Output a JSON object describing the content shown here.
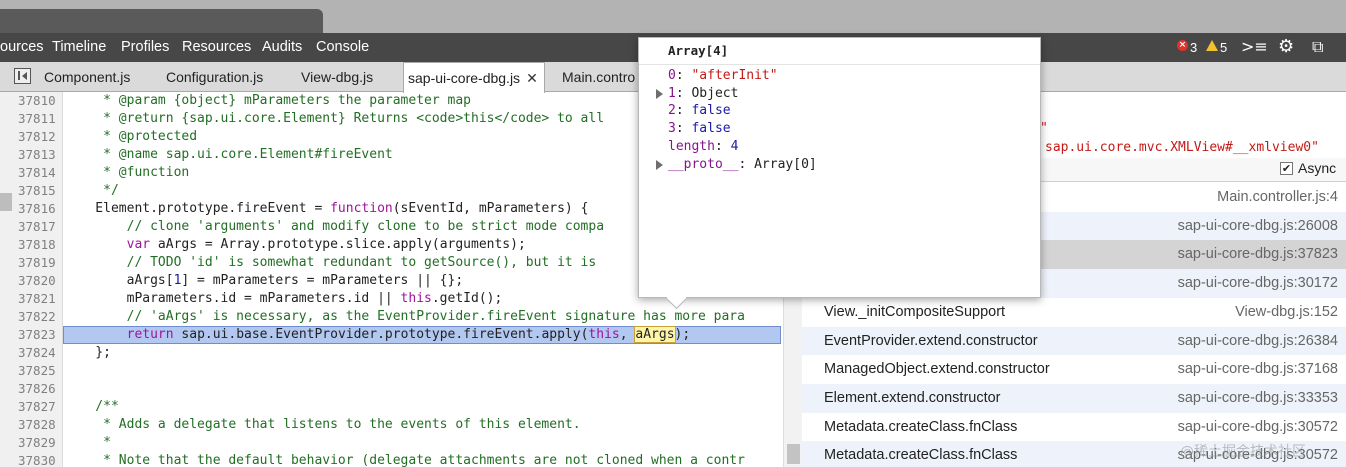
{
  "nav": {
    "items": [
      "ources",
      "Timeline",
      "Profiles",
      "Resources",
      "Audits",
      "Console"
    ],
    "errors": "3",
    "warnings": "5"
  },
  "file_tabs": [
    {
      "label": "Component.js",
      "active": false
    },
    {
      "label": "Configuration.js",
      "active": false
    },
    {
      "label": "View-dbg.js",
      "active": false
    },
    {
      "label": "sap-ui-core-dbg.js",
      "active": true
    },
    {
      "label": "Main.contro",
      "active": false
    }
  ],
  "close_glyph": "✕",
  "code_lines": [
    {
      "n": "37810",
      "html": "<span class=\"c\">     * @param {object} mParameters the parameter map</span>"
    },
    {
      "n": "37811",
      "html": "<span class=\"c\">     * @return {sap.ui.core.Element} Returns &lt;code&gt;this&lt;/code&gt; to all</span>"
    },
    {
      "n": "37812",
      "html": "<span class=\"c\">     * @protected</span>"
    },
    {
      "n": "37813",
      "html": "<span class=\"c\">     * @name sap.ui.core.Element#fireEvent</span>"
    },
    {
      "n": "37814",
      "html": "<span class=\"c\">     * @function</span>"
    },
    {
      "n": "37815",
      "html": "<span class=\"c\">     */</span>"
    },
    {
      "n": "37816",
      "html": "    Element.prototype.fireEvent = <span class=\"k\">function</span>(sEventId, mParameters) {"
    },
    {
      "n": "37817",
      "html": "<span class=\"c\">        // clone 'arguments' and modify clone to be strict mode compa</span>"
    },
    {
      "n": "37818",
      "html": "        <span class=\"k\">var</span> aArgs = Array.prototype.slice.apply(arguments);"
    },
    {
      "n": "37819",
      "html": "<span class=\"c\">        // TODO 'id' is somewhat redundant to getSource(), but it is</span>"
    },
    {
      "n": "37820",
      "html": "        aArgs[<span class=\"n\">1</span>] = mParameters = mParameters || {};"
    },
    {
      "n": "37821",
      "html": "        mParameters.id = mParameters.id || <span class=\"k\">this</span>.getId();"
    },
    {
      "n": "37822",
      "html": "<span class=\"c\">        // 'aArgs' is necessary, as the EventProvider.fireEvent signature has more para</span>"
    },
    {
      "n": "37823",
      "html": "        <span class=\"k\">return</span> sap.ui.base.EventProvider.prototype.fireEvent.apply(<span class=\"k\">this</span>, <span class=\"tok\">aArgs</span>);",
      "highlight": true
    },
    {
      "n": "37824",
      "html": "    };"
    },
    {
      "n": "37825",
      "html": ""
    },
    {
      "n": "37826",
      "html": ""
    },
    {
      "n": "37827",
      "html": "<span class=\"c\">    /**</span>"
    },
    {
      "n": "37828",
      "html": "<span class=\"c\">     * Adds a delegate that listens to the events of this element.</span>"
    },
    {
      "n": "37829",
      "html": "<span class=\"c\">     *</span>"
    },
    {
      "n": "37830",
      "html": "<span class=\"c\">     * Note that the default behavior (delegate attachments are not cloned when a contr</span>"
    }
  ],
  "popover": {
    "title": "Array[4]",
    "rows": [
      {
        "key": "0",
        "value": "\"afterInit\"",
        "vclass": "ps",
        "tri": false
      },
      {
        "key": "1",
        "value": "Object",
        "vclass": "pp",
        "tri": true
      },
      {
        "key": "2",
        "value": "false",
        "vclass": "pb",
        "tri": false
      },
      {
        "key": "3",
        "value": "false",
        "vclass": "pb",
        "tri": false
      },
      {
        "key": "length",
        "value": "4",
        "vclass": "pb",
        "tri": false
      },
      {
        "key": "__proto__",
        "value": "Array[0]",
        "vclass": "pp",
        "tri": true
      }
    ]
  },
  "right_panel": {
    "red_text_1": "\"",
    "red_text_2": "sap.ui.core.mvc.XMLView#__xmlview0\"",
    "async_label": "Async",
    "async_checked": "✔",
    "frames": [
      {
        "name": "",
        "loc": "Main.controller.js:4",
        "bg": "#ffffff"
      },
      {
        "name": "",
        "loc": "sap-ui-core-dbg.js:26008",
        "bg": "#eef3fb"
      },
      {
        "name": "",
        "loc": "sap-ui-core-dbg.js:37823",
        "bg": "#d4d4d4"
      },
      {
        "name": "",
        "loc": "sap-ui-core-dbg.js:30172",
        "bg": "#eef3fb"
      },
      {
        "name": "View._initCompositeSupport",
        "loc": "View-dbg.js:152",
        "bg": "#ffffff"
      },
      {
        "name": "EventProvider.extend.constructor",
        "loc": "sap-ui-core-dbg.js:26384",
        "bg": "#eef3fb"
      },
      {
        "name": "ManagedObject.extend.constructor",
        "loc": "sap-ui-core-dbg.js:37168",
        "bg": "#ffffff"
      },
      {
        "name": "Element.extend.constructor",
        "loc": "sap-ui-core-dbg.js:33353",
        "bg": "#eef3fb"
      },
      {
        "name": "Metadata.createClass.fnClass",
        "loc": "sap-ui-core-dbg.js:30572",
        "bg": "#ffffff"
      },
      {
        "name": "Metadata.createClass.fnClass",
        "loc": "sap-ui-core-dbg.js:30572",
        "bg": "#eef3fb"
      }
    ]
  },
  "watermark": "@稀土掘金技术社区"
}
